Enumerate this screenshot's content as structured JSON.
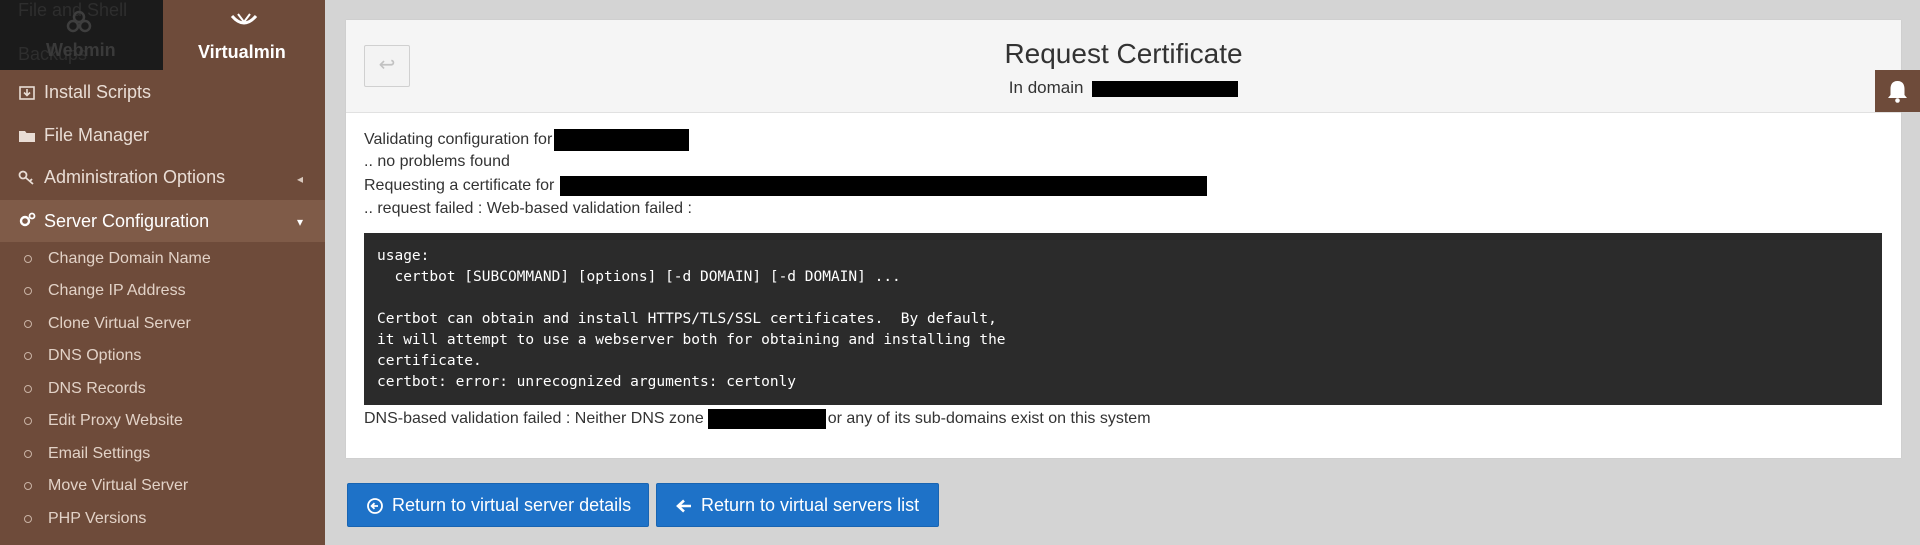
{
  "sidebar": {
    "tabs": [
      {
        "label": "Webmin",
        "ghost_top": "File and Shell",
        "ghost_bottom": "Backups"
      },
      {
        "label": "Virtualmin"
      }
    ],
    "menu": [
      {
        "label": "Install Scripts",
        "icon": "install-scripts-icon"
      },
      {
        "label": "File Manager",
        "icon": "folder-icon"
      },
      {
        "label": "Administration Options",
        "icon": "key-icon",
        "caret": "◂"
      },
      {
        "label": "Server Configuration",
        "icon": "gears-icon",
        "caret": "▾"
      }
    ],
    "sub_items": [
      "Change Domain Name",
      "Change IP Address",
      "Clone Virtual Server",
      "DNS Options",
      "DNS Records",
      "Edit Proxy Website",
      "Email Settings",
      "Move Virtual Server",
      "PHP Versions"
    ]
  },
  "header": {
    "back_icon": "↩",
    "title": "Request Certificate",
    "subtitle_prefix": "In domain"
  },
  "content": {
    "line1": "Validating configuration for",
    "line2": ".. no problems found",
    "line3": "Requesting a certificate for",
    "line4": ".. request failed : Web-based validation failed :",
    "console": "usage:\n  certbot [SUBCOMMAND] [options] [-d DOMAIN] [-d DOMAIN] ...\n\nCertbot can obtain and install HTTPS/TLS/SSL certificates.  By default,\nit will attempt to use a webserver both for obtaining and installing the\ncertificate.\ncertbot: error: unrecognized arguments: certonly",
    "dns_prefix": "DNS-based validation failed : Neither DNS zone",
    "dns_suffix": "or any of its sub-domains exist on this system"
  },
  "buttons": {
    "return_details": "Return to virtual server details",
    "return_list": "Return to virtual servers list"
  },
  "colors": {
    "sidebar": "#6e4b3a",
    "accent": "#1e72c8",
    "console": "#2b2b2b"
  }
}
